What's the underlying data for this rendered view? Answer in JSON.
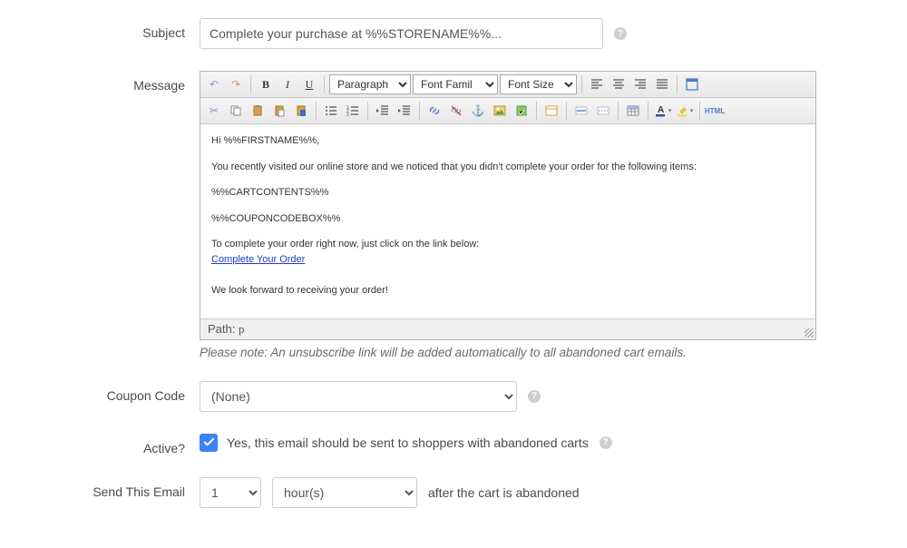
{
  "labels": {
    "subject": "Subject",
    "message": "Message",
    "coupon": "Coupon Code",
    "active": "Active?",
    "send": "Send This Email"
  },
  "subject": {
    "value": "Complete your purchase at %%STORENAME%%..."
  },
  "editor": {
    "format_sel": "Paragraph",
    "family_sel": "Font Famil",
    "size_sel": "Font Size",
    "body": {
      "greeting": "Hi %%FIRSTNAME%%,",
      "l1": "You recently visited our online store and we noticed that you didn't complete your order for the following items:",
      "l2": "%%CARTCONTENTS%%",
      "l3": "%%COUPONCODEBOX%%",
      "l4": "To complete your order right now, just click on the link below:",
      "link": "Complete Your Order",
      "l5": "We look forward to receiving your order!"
    },
    "path_label": "Path:",
    "path_value": "p",
    "note": "Please note: An unsubscribe link will be added automatically to all abandoned cart emails."
  },
  "coupon": {
    "value": "(None)"
  },
  "active": {
    "checked": true,
    "text": "Yes, this email should be sent to shoppers with abandoned carts"
  },
  "send": {
    "num": "1",
    "unit": "hour(s)",
    "after": "after the cart is abandoned"
  }
}
